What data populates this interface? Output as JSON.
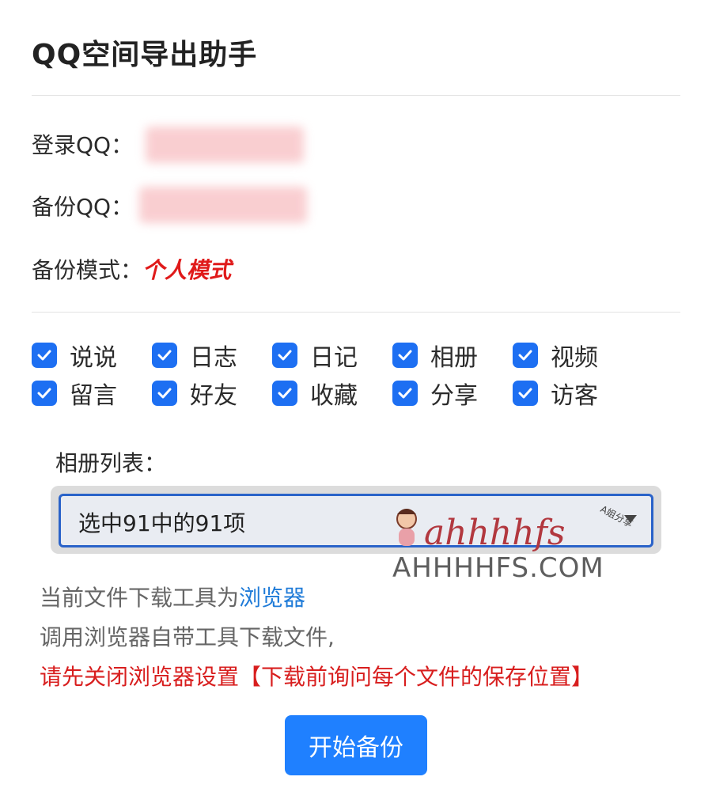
{
  "app": {
    "title": "QQ空间导出助手"
  },
  "account": {
    "login_label": "登录QQ：",
    "backup_label": "备份QQ：",
    "mode_label": "备份模式：",
    "mode_value": "个人模式"
  },
  "options": [
    {
      "label": "说说",
      "checked": true
    },
    {
      "label": "日志",
      "checked": true
    },
    {
      "label": "日记",
      "checked": true
    },
    {
      "label": "相册",
      "checked": true
    },
    {
      "label": "视频",
      "checked": true
    },
    {
      "label": "留言",
      "checked": true
    },
    {
      "label": "好友",
      "checked": true
    },
    {
      "label": "收藏",
      "checked": true
    },
    {
      "label": "分享",
      "checked": true
    },
    {
      "label": "访客",
      "checked": true
    }
  ],
  "album": {
    "label": "相册列表：",
    "selected": "选中91中的91项"
  },
  "watermark": {
    "logo_text": "ahhhhfs",
    "badge_text": "A姐分享",
    "site": "AHHHHFS.COM"
  },
  "info": {
    "line1_prefix": "当前文件下载工具为",
    "line1_link": "浏览器",
    "line2": "调用浏览器自带工具下载文件,",
    "line3": "请先关闭浏览器设置【下载前询问每个文件的保存位置】"
  },
  "start_button": "开始备份",
  "colors": {
    "accent": "#1f80ff",
    "checkbox": "#1d6ff2",
    "warning": "#d81e1e",
    "link": "#1f7bd8"
  }
}
